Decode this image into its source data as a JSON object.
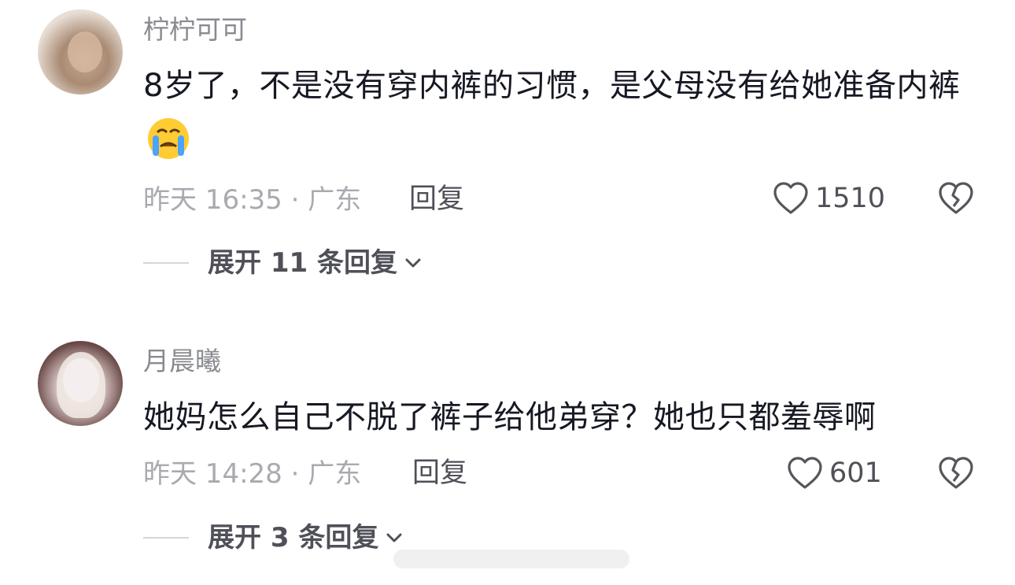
{
  "comments": [
    {
      "username": "柠柠可可",
      "content": "8岁了，不是没有穿内裤的习惯，是父母没有给她准备内裤",
      "emoji": "crying-face-emoji",
      "time": "昨天 16:35",
      "location": "广东",
      "meta": "昨天 16:35 · 广东",
      "reply_label": "回复",
      "likes": "1510",
      "expand_label": "展开 11 条回复"
    },
    {
      "username": "月晨曦",
      "content": "她妈怎么自己不脱了裤子给他弟穿？她也只都羞辱啊",
      "time": "昨天 14:28",
      "location": "广东",
      "meta": "昨天 14:28 · 广东",
      "reply_label": "回复",
      "likes": "601",
      "expand_label": "展开 3 条回复"
    }
  ],
  "icons": {
    "like": "heart-outline-icon",
    "dislike": "broken-heart-icon",
    "expand": "chevron-down-icon"
  },
  "colors": {
    "username": "#8a8b91",
    "text": "#161823",
    "meta": "#a9aab0",
    "action": "#4f5058"
  }
}
